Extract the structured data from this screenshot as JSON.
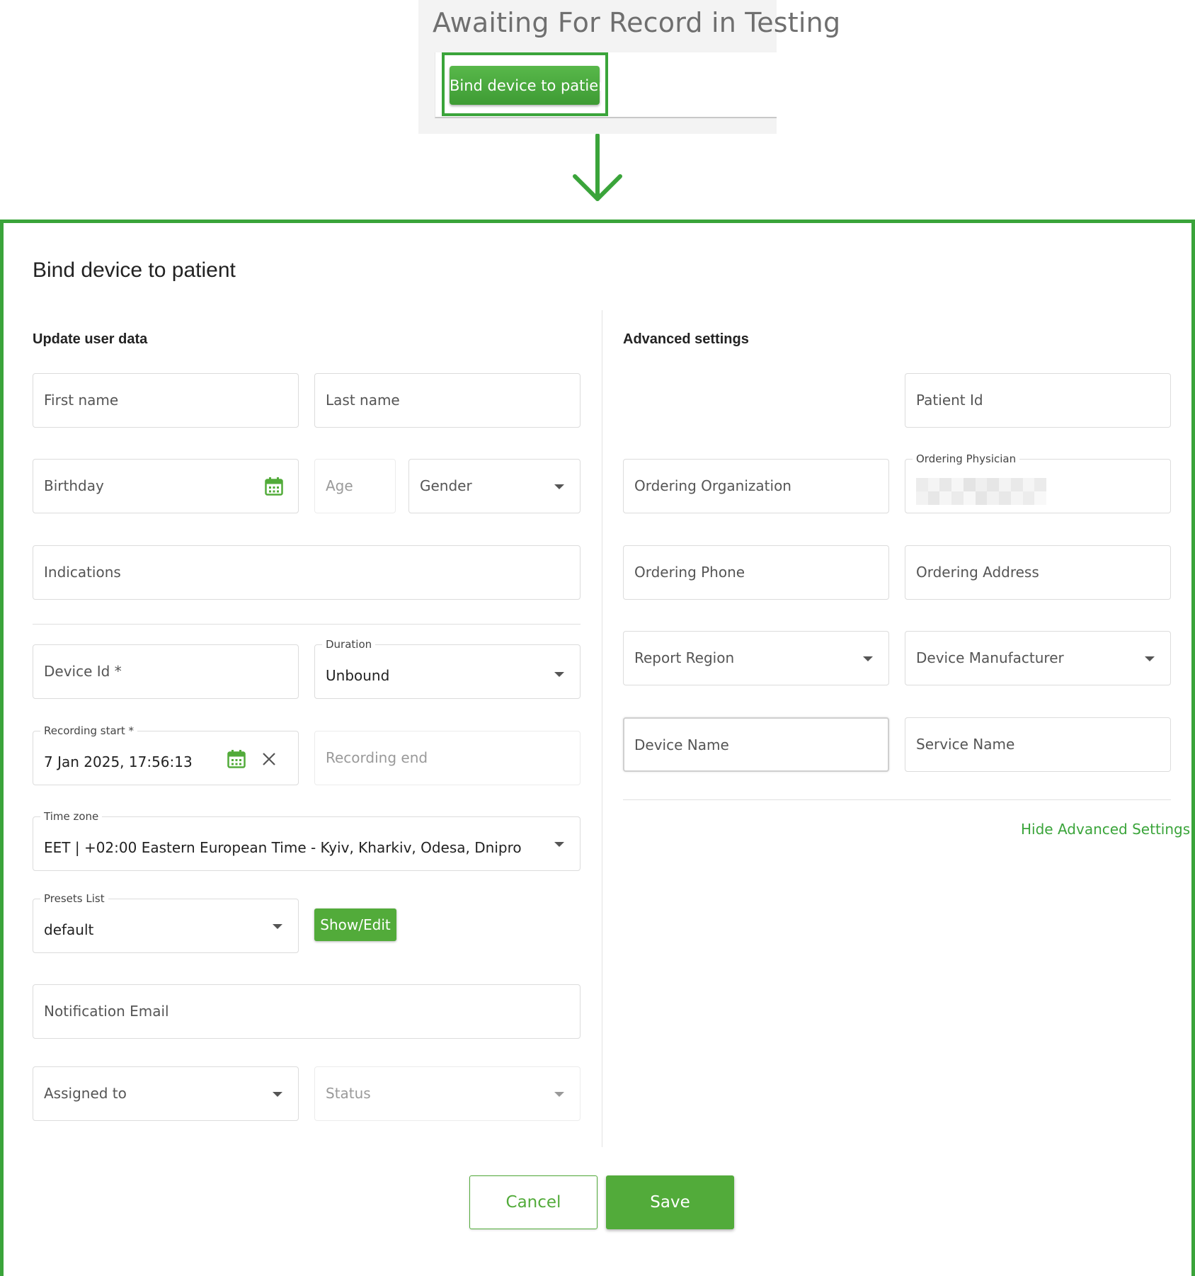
{
  "top": {
    "title": "Awaiting For Record in Testing",
    "bind_button_label": "Bind device to patient"
  },
  "dialog": {
    "title": "Bind device to patient",
    "left": {
      "section_title": "Update user data",
      "first_name": "First name",
      "last_name": "Last name",
      "birthday": "Birthday",
      "age": "Age",
      "gender": "Gender",
      "indications": "Indications",
      "device_id": "Device Id *",
      "duration_label": "Duration",
      "duration_value": "Unbound",
      "recording_start_label": "Recording start *",
      "recording_start_value": "7 Jan 2025, 17:56:13",
      "recording_end": "Recording end",
      "timezone_label": "Time zone",
      "timezone_value": "EET | +02:00 Eastern European Time - Kyiv, Kharkiv, Odesa, Dnipro",
      "presets_label": "Presets List",
      "presets_value": "default",
      "show_edit_label": "Show/Edit",
      "notification_email": "Notification Email",
      "assigned_to": "Assigned to",
      "status": "Status"
    },
    "right": {
      "section_title": "Advanced settings",
      "patient_id": "Patient Id",
      "ordering_organization": "Ordering Organization",
      "ordering_physician_label": "Ordering Physician",
      "ordering_phone": "Ordering Phone",
      "ordering_address": "Ordering Address",
      "report_region": "Report Region",
      "device_manufacturer": "Device Manufacturer",
      "device_name": "Device Name",
      "service_name": "Service Name",
      "hide_advanced_label": "Hide Advanced Settings"
    },
    "cancel_label": "Cancel",
    "save_label": "Save"
  },
  "colors": {
    "accent_green": "#52ab3a",
    "highlight_green": "#3aa43a"
  },
  "icons": [
    "arrow-down-icon",
    "calendar-icon",
    "close-icon",
    "chevron-down-icon"
  ]
}
